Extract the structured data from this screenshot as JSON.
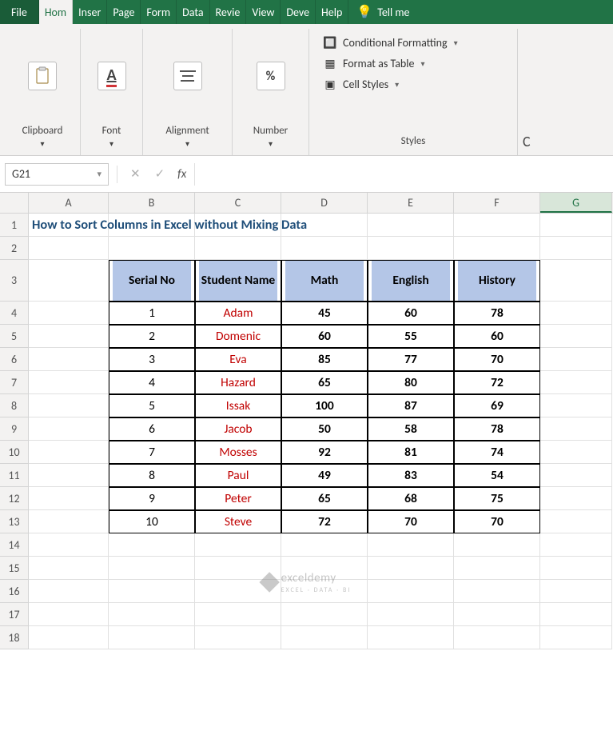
{
  "tabs": {
    "file": "File",
    "home": "Hom",
    "insert": "Inser",
    "page": "Page",
    "form": "Form",
    "data": "Data",
    "review": "Revie",
    "view": "View",
    "dev": "Deve",
    "help": "Help",
    "tellme": "Tell me"
  },
  "ribbon": {
    "clipboard": "Clipboard",
    "font": "Font",
    "alignment": "Alignment",
    "number": "Number",
    "number_icon": "%",
    "font_icon": "A",
    "cond_format": "Conditional Formatting",
    "format_table": "Format as Table",
    "cell_styles": "Cell Styles",
    "styles": "Styles",
    "cells_letter": "C"
  },
  "namebox": "G21",
  "formula": "",
  "columns": [
    "A",
    "B",
    "C",
    "D",
    "E",
    "F",
    "G"
  ],
  "col_widths": [
    "wA",
    "wB",
    "wC",
    "wD",
    "wE",
    "wF",
    "wG"
  ],
  "title": "How to Sort Columns in Excel without Mixing Data",
  "table": {
    "headers": [
      "Serial No",
      "Student Name",
      "Math",
      "English",
      "History"
    ],
    "rows": [
      {
        "serial": "1",
        "name": "Adam",
        "math": "45",
        "english": "60",
        "history": "78"
      },
      {
        "serial": "2",
        "name": "Domenic",
        "math": "60",
        "english": "55",
        "history": "60"
      },
      {
        "serial": "3",
        "name": "Eva",
        "math": "85",
        "english": "77",
        "history": "70"
      },
      {
        "serial": "4",
        "name": "Hazard",
        "math": "65",
        "english": "80",
        "history": "72"
      },
      {
        "serial": "5",
        "name": "Issak",
        "math": "100",
        "english": "87",
        "history": "69"
      },
      {
        "serial": "6",
        "name": "Jacob",
        "math": "50",
        "english": "58",
        "history": "78"
      },
      {
        "serial": "7",
        "name": "Mosses",
        "math": "92",
        "english": "81",
        "history": "74"
      },
      {
        "serial": "8",
        "name": "Paul",
        "math": "49",
        "english": "83",
        "history": "54"
      },
      {
        "serial": "9",
        "name": "Peter",
        "math": "65",
        "english": "68",
        "history": "75"
      },
      {
        "serial": "10",
        "name": "Steve",
        "math": "72",
        "english": "70",
        "history": "70"
      }
    ]
  },
  "watermark": {
    "brand": "exceldemy",
    "sub": "EXCEL · DATA · BI"
  },
  "chart_data": {
    "type": "table",
    "title": "How to Sort Columns in Excel without Mixing Data",
    "columns": [
      "Serial No",
      "Student Name",
      "Math",
      "English",
      "History"
    ],
    "rows": [
      [
        1,
        "Adam",
        45,
        60,
        78
      ],
      [
        2,
        "Domenic",
        60,
        55,
        60
      ],
      [
        3,
        "Eva",
        85,
        77,
        70
      ],
      [
        4,
        "Hazard",
        65,
        80,
        72
      ],
      [
        5,
        "Issak",
        100,
        87,
        69
      ],
      [
        6,
        "Jacob",
        50,
        58,
        78
      ],
      [
        7,
        "Mosses",
        92,
        81,
        74
      ],
      [
        8,
        "Paul",
        49,
        83,
        54
      ],
      [
        9,
        "Peter",
        65,
        68,
        75
      ],
      [
        10,
        "Steve",
        72,
        70,
        70
      ]
    ]
  }
}
